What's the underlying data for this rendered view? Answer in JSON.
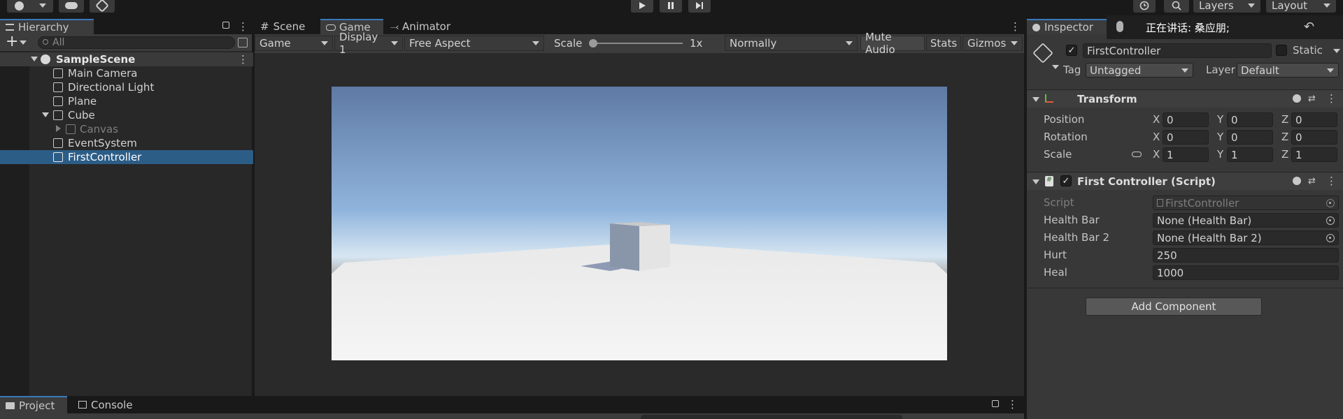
{
  "hierarchy": {
    "tab_label": "Hierarchy",
    "add_label": "+",
    "search_placeholder": "All",
    "scene": "SampleScene",
    "items": [
      {
        "label": "Main Camera"
      },
      {
        "label": "Directional Light"
      },
      {
        "label": "Plane"
      },
      {
        "label": "Cube"
      },
      {
        "label": "Canvas"
      },
      {
        "label": "EventSystem"
      },
      {
        "label": "FirstController"
      }
    ]
  },
  "scene_tabs": [
    {
      "label": "Scene"
    },
    {
      "label": "Game"
    },
    {
      "label": "Animator"
    }
  ],
  "game_toolbar": {
    "mode": "Game",
    "display": "Display 1",
    "aspect": "Free Aspect",
    "scale_label": "Scale",
    "scale_value": "1x",
    "play_focus": "Normally",
    "mute_audio": "Mute Audio",
    "stats": "Stats",
    "gizmos": "Gizmos"
  },
  "top_right": {
    "layers": "Layers",
    "layout": "Layout"
  },
  "inspector": {
    "tab_label": "Inspector",
    "object_name": "FirstController",
    "static_label": "Static",
    "tag_label": "Tag",
    "tag_value": "Untagged",
    "layer_label": "Layer",
    "layer_value": "Default",
    "transform": {
      "title": "Transform",
      "rows": [
        {
          "label": "Position",
          "x": "0",
          "y": "0",
          "z": "0"
        },
        {
          "label": "Rotation",
          "x": "0",
          "y": "0",
          "z": "0"
        },
        {
          "label": "Scale",
          "x": "1",
          "y": "1",
          "z": "1"
        }
      ],
      "axis_x": "X",
      "axis_y": "Y",
      "axis_z": "Z"
    },
    "script_component": {
      "title": "First Controller (Script)",
      "script_label": "Script",
      "script_value": "FirstController",
      "fields": [
        {
          "label": "Health Bar",
          "value": "None (Health Bar)"
        },
        {
          "label": "Health Bar 2",
          "value": "None (Health Bar 2)"
        },
        {
          "label": "Hurt",
          "value": "250"
        },
        {
          "label": "Heal",
          "value": "1000"
        }
      ]
    },
    "add_component": "Add Component"
  },
  "notification": {
    "text": "正在讲话: 桑应朋;"
  },
  "bottom_tabs": [
    {
      "label": "Project"
    },
    {
      "label": "Console"
    }
  ],
  "colors": {
    "selection": "#2c5d87",
    "sky_top": "#6282ac",
    "ground": "#f2f2f2",
    "accent": "#3a79bb"
  }
}
